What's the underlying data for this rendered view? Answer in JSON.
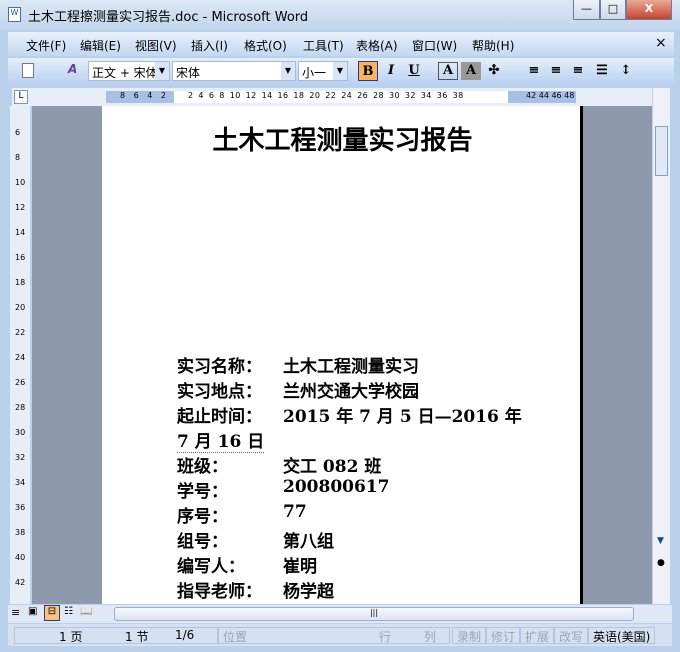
{
  "window": {
    "title": "土木工程擦测量实习报告.doc - Microsoft Word",
    "minimize": "—",
    "maximize": "□",
    "close": "X"
  },
  "menu": [
    "文件(F)",
    "编辑(E)",
    "视图(V)",
    "插入(I)",
    "格式(O)",
    "工具(T)",
    "表格(A)",
    "窗口(W)",
    "帮助(H)"
  ],
  "menu_close": "×",
  "toolbar": {
    "style": "正文 + 宋体",
    "font": "宋体",
    "size": "小一",
    "bold": "B",
    "italic": "I",
    "underline": "U",
    "char_border": "A",
    "char_shade": "A"
  },
  "ruler": {
    "left": "8 6 4 2",
    "right": "2 4 6 8 10 12 14 16 18 20 22 24 26 28 30 32 34 36 38",
    "after": "42 44 46 48"
  },
  "vruler": [
    "6",
    "8",
    "10",
    "12",
    "14",
    "16",
    "18",
    "20",
    "22",
    "24",
    "26",
    "28",
    "30",
    "32",
    "34",
    "36",
    "38",
    "40",
    "42"
  ],
  "document": {
    "title": "土木工程测量实习报告",
    "fields": [
      {
        "label": "实习名称：",
        "value": "土木工程测量实习"
      },
      {
        "label": "实习地点：",
        "value": "兰州交通大学校园"
      },
      {
        "label": "起止时间：",
        "value": "2015 年 7 月 5 日—2016 年"
      },
      {
        "label": "",
        "value": "7 月 16 日",
        "indent": false
      },
      {
        "label": "班级：",
        "value": "交工 082 班"
      },
      {
        "label": "学号：",
        "value": "200800617"
      },
      {
        "label": "序号：",
        "value": "77"
      },
      {
        "label": "组号：",
        "value": "第八组"
      },
      {
        "label": "编写人：",
        "value": "崔明"
      },
      {
        "label": "指导老师：",
        "value": "杨学超"
      }
    ]
  },
  "status": {
    "page": "1 页",
    "section": "1 节",
    "pages": "1/6",
    "position": "位置",
    "line": "行",
    "col": "列",
    "rec": "录制",
    "trk": "修订",
    "ext": "扩展",
    "ovr": "改写",
    "lang": "英语(美国)"
  }
}
